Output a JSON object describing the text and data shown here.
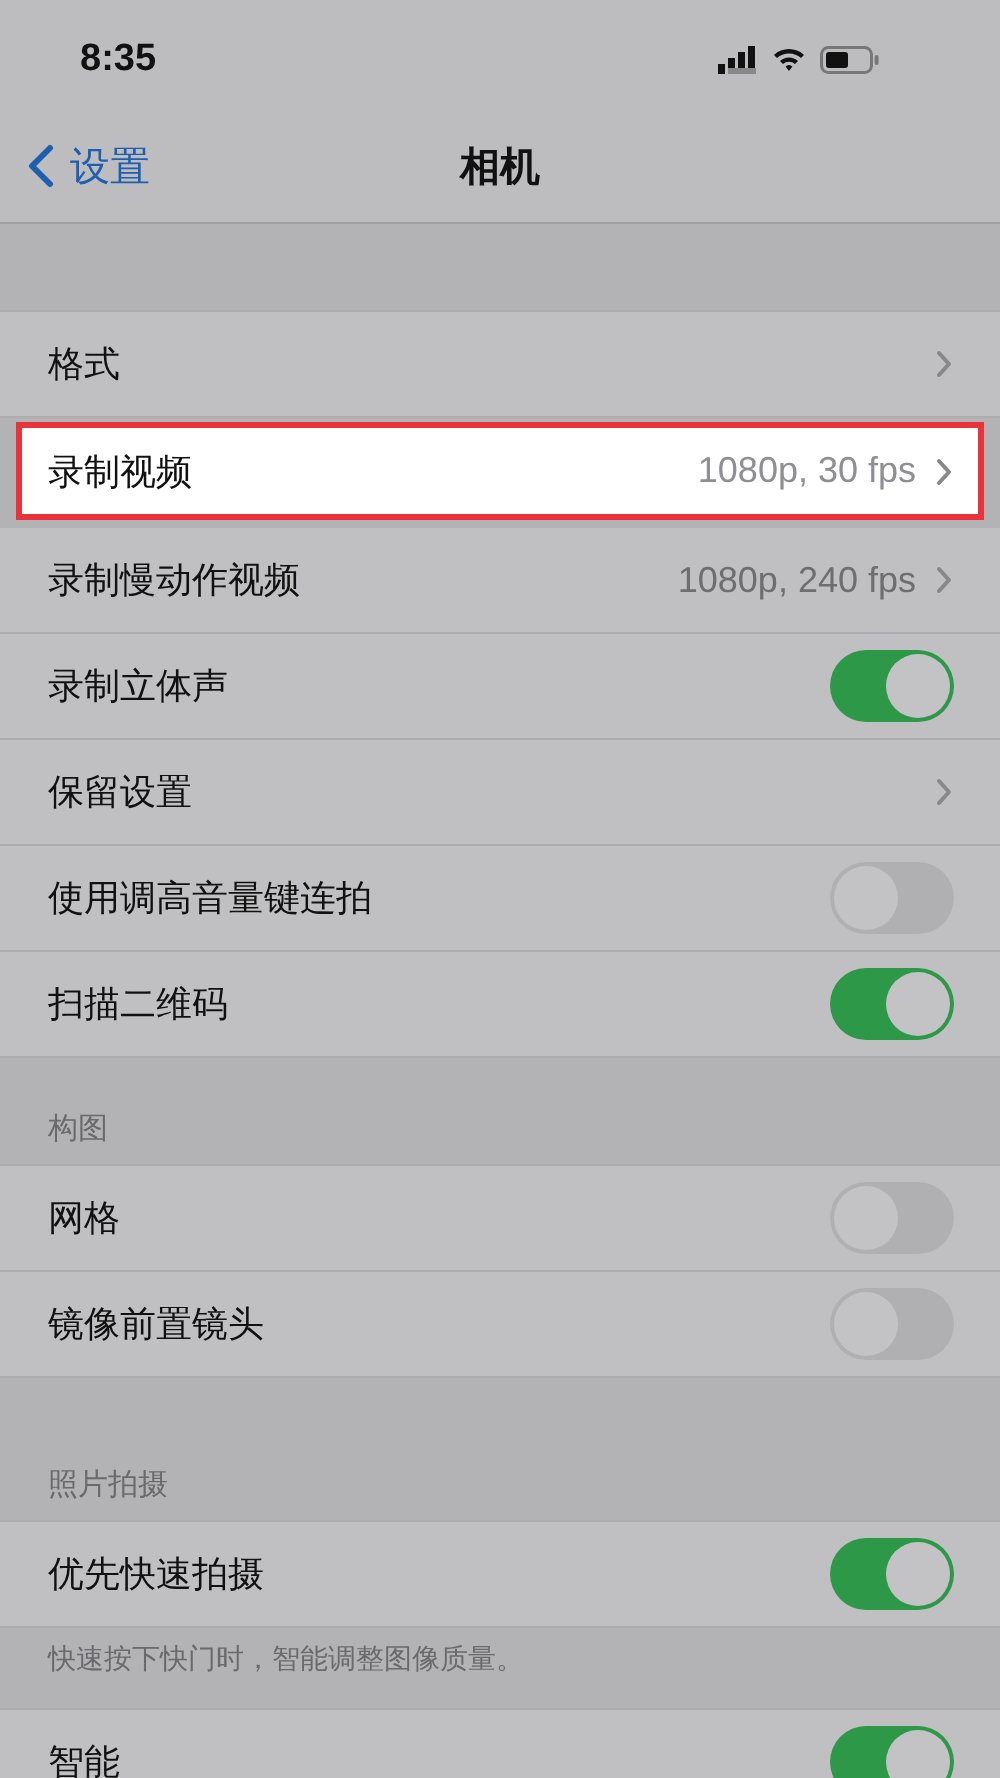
{
  "status_bar": {
    "time": "8:35"
  },
  "nav": {
    "back": "设置",
    "title": "相机"
  },
  "sections": [
    {
      "rows": [
        {
          "label": "格式",
          "kind": "disclosure",
          "highlighted": false
        },
        {
          "label": "录制视频",
          "kind": "disclosure",
          "value": "1080p, 30 fps",
          "highlighted": true
        },
        {
          "label": "录制慢动作视频",
          "kind": "disclosure",
          "value": "1080p, 240 fps",
          "highlighted": false
        },
        {
          "label": "录制立体声",
          "kind": "toggle",
          "on": true,
          "highlighted": false
        },
        {
          "label": "保留设置",
          "kind": "disclosure",
          "highlighted": false
        },
        {
          "label": "使用调高音量键连拍",
          "kind": "toggle",
          "on": false,
          "highlighted": false
        },
        {
          "label": "扫描二维码",
          "kind": "toggle",
          "on": true,
          "highlighted": false
        }
      ]
    },
    {
      "header": "构图",
      "rows": [
        {
          "label": "网格",
          "kind": "toggle",
          "on": false,
          "highlighted": false
        },
        {
          "label": "镜像前置镜头",
          "kind": "toggle",
          "on": false,
          "highlighted": false
        }
      ]
    },
    {
      "header": "照片拍摄",
      "footer": "快速按下快门时，智能调整图像质量。",
      "rows": [
        {
          "label": "优先快速拍摄",
          "kind": "toggle",
          "on": true,
          "highlighted": false
        }
      ]
    },
    {
      "rows": [
        {
          "label": "智能",
          "kind": "toggle",
          "on": true,
          "highlighted": false
        }
      ]
    }
  ]
}
